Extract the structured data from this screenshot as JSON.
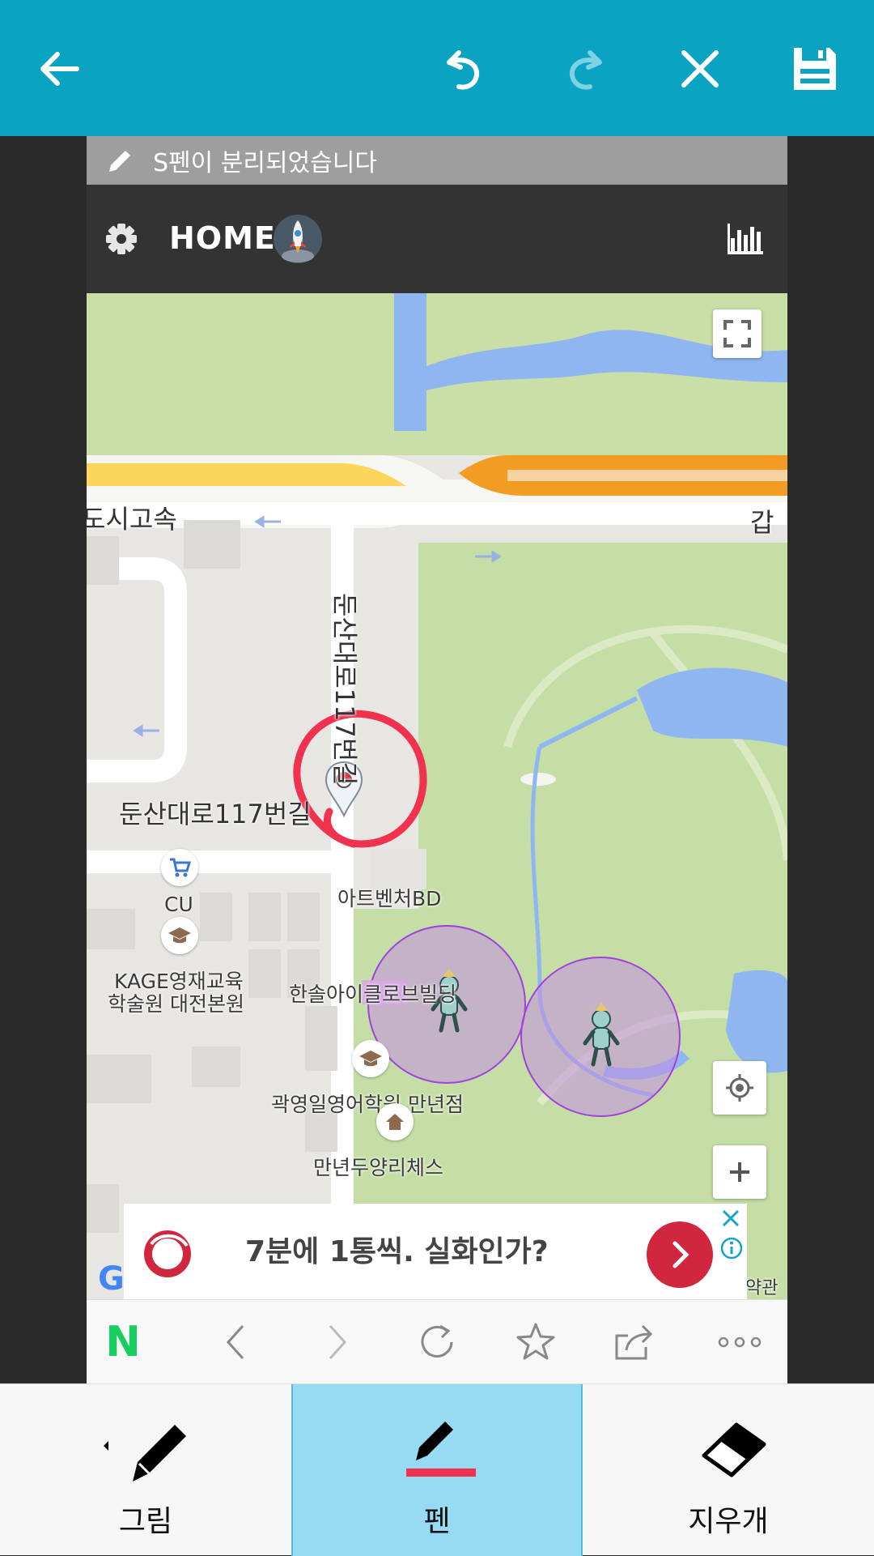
{
  "toolbar": {
    "icons": [
      "back-arrow-icon",
      "undo-icon",
      "redo-icon",
      "close-icon",
      "save-icon"
    ]
  },
  "spen_notice": {
    "text": "S펜이 분리되었습니다"
  },
  "app": {
    "title": "HOME"
  },
  "map": {
    "road_labels": {
      "expressway": "도시고속",
      "road_vertical": "둔산대로117번길",
      "road_horizontal": "둔산대로117번길",
      "right_edge": "갑"
    },
    "places": {
      "cu": "CU",
      "art_venture": "아트벤처BD",
      "kage_line1": "KAGE영재교육",
      "kage_line2": "학술원 대전본원",
      "hansol": "한솔아이클로브빌딩",
      "kwak": "곽영일영어학원 만년점",
      "chess": "만년두양리체스"
    },
    "terms": "약관",
    "google": "G"
  },
  "ad": {
    "text": "7분에 1통씩. 실화인가?"
  },
  "browser": {
    "naver": "N",
    "icons": [
      "back-icon",
      "forward-icon",
      "refresh-icon",
      "star-icon",
      "share-icon",
      "more-icon"
    ]
  },
  "tools": [
    {
      "label": "그림",
      "active": false
    },
    {
      "label": "펜",
      "active": true
    },
    {
      "label": "지우개",
      "active": false
    }
  ],
  "colors": {
    "toolbar": "#0aa3c1",
    "active_tool": "#97dbf2",
    "pen_color": "#f0324f",
    "app_header": "#333333"
  }
}
